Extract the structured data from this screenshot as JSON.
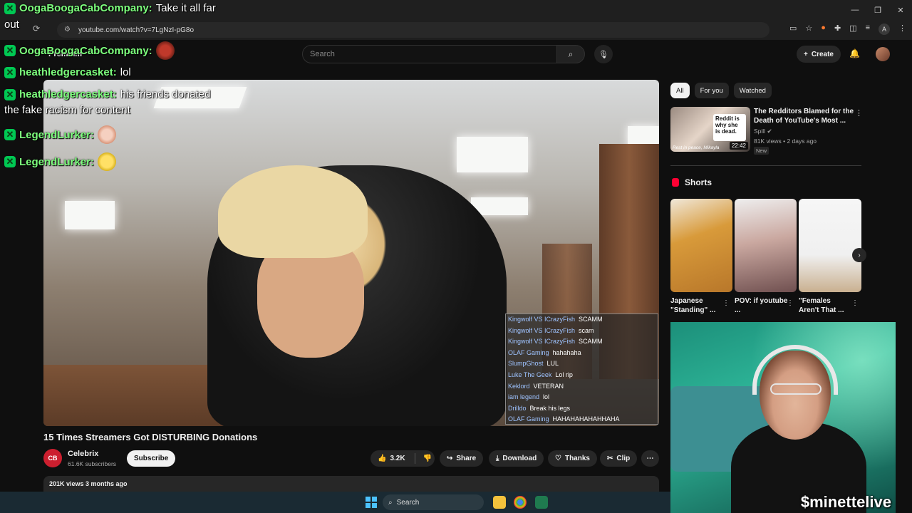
{
  "browser": {
    "url": "youtube.com/watch?v=7LgNzI-pG8o",
    "window_controls": [
      "—",
      "❐",
      "✕"
    ],
    "profile_letter": "A"
  },
  "youtube_header": {
    "premium_label": "Premium",
    "search_placeholder": "Search",
    "create_label": "Create"
  },
  "video": {
    "title": "15 Times Streamers Got DISTURBING Donations",
    "channel": {
      "avatar_text": "CB",
      "name": "Celebrix",
      "subscribers": "61.6K subscribers",
      "subscribe_label": "Subscribe"
    },
    "actions": {
      "likes": "3.2K",
      "share": "Share",
      "download": "Download",
      "thanks": "Thanks",
      "clip": "Clip"
    },
    "views_line": "201K views  3 months ago",
    "stream_chat": [
      {
        "user": "Kingwolf VS ICrazyFish",
        "msg": "SCAMM"
      },
      {
        "user": "Kingwolf VS ICrazyFish",
        "msg": "scam"
      },
      {
        "user": "Kingwolf VS ICrazyFish",
        "msg": "SCAMM"
      },
      {
        "user": "OLAF Gaming",
        "msg": "hahahaha"
      },
      {
        "user": "SlumpGhost",
        "msg": "LUL"
      },
      {
        "user": "Luke The Geek",
        "msg": "Lol rip"
      },
      {
        "user": "Keklord",
        "msg": "VETERAN"
      },
      {
        "user": "iam legend",
        "msg": "lol"
      },
      {
        "user": "Drilldo",
        "msg": "Break his legs"
      },
      {
        "user": "OLAF Gaming",
        "msg": "HAHAHAHAHAHHAHA"
      }
    ]
  },
  "sidebar": {
    "chips": [
      "All",
      "For you",
      "Watched"
    ],
    "recommended": {
      "title": "The Redditors Blamed for the Death of YouTube's Most ...",
      "channel": "Spill",
      "meta": "81K views • 2 days ago",
      "badge": "New",
      "duration": "22:42",
      "thumb_card_text": "Reddit is why she is dead.",
      "thumb_caption": "Rest in peace, Mikayla"
    },
    "shorts_label": "Shorts",
    "shorts": [
      {
        "title": "Japanese \"Standing\" ..."
      },
      {
        "title": "POV: if youtube ..."
      },
      {
        "title": "\"Females Aren't That ..."
      }
    ]
  },
  "overlay_chat": {
    "line1_user": "OogaBoogaCabCompany:",
    "line1_msg": "Take it all far",
    "line1_wrap": "out",
    "line2_user": "OogaBoogaCabCompany:",
    "line3_user": "heathledgercasket:",
    "line3_msg": "lol",
    "line4_user": "heathledgercasket:",
    "line4_msg": "his friends donated",
    "line4_wrap": "the fake racism for content",
    "line5_user": "LegendLurker:",
    "line6_user": "LegendLurker:"
  },
  "webcam": {
    "tag": "$minettelive"
  },
  "taskbar": {
    "search_label": "Search"
  }
}
